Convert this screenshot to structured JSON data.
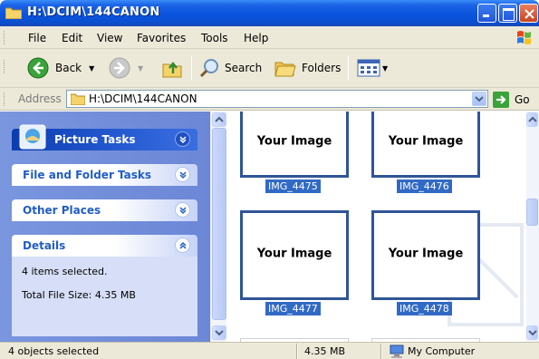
{
  "window": {
    "title": "H:\\DCIM\\144CANON"
  },
  "menu": [
    "File",
    "Edit",
    "View",
    "Favorites",
    "Tools",
    "Help"
  ],
  "toolbar": {
    "back_label": "Back",
    "search_label": "Search",
    "folders_label": "Folders"
  },
  "address": {
    "label": "Address",
    "value": "H:\\DCIM\\144CANON",
    "go_label": "Go"
  },
  "tasks": {
    "picture_tasks": "Picture Tasks",
    "file_folder_tasks": "File and Folder Tasks",
    "other_places": "Other Places",
    "details": {
      "title": "Details",
      "line1": "4 items selected.",
      "line2": "Total File Size: 4.35 MB"
    }
  },
  "thumbnails": [
    {
      "image_text": "Your Image",
      "filename": "IMG_4475"
    },
    {
      "image_text": "Your Image",
      "filename": "IMG_4476"
    },
    {
      "image_text": "Your Image",
      "filename": "IMG_4477"
    },
    {
      "image_text": "Your Image",
      "filename": "IMG_4478"
    }
  ],
  "status": {
    "objects": "4 objects selected",
    "size": "4.35 MB",
    "location": "My Computer"
  },
  "colors": {
    "title_blue": "#0a54dd",
    "selection_blue": "#316ac5",
    "thumb_border": "#2f5597",
    "task_pane": "#7a96df"
  }
}
